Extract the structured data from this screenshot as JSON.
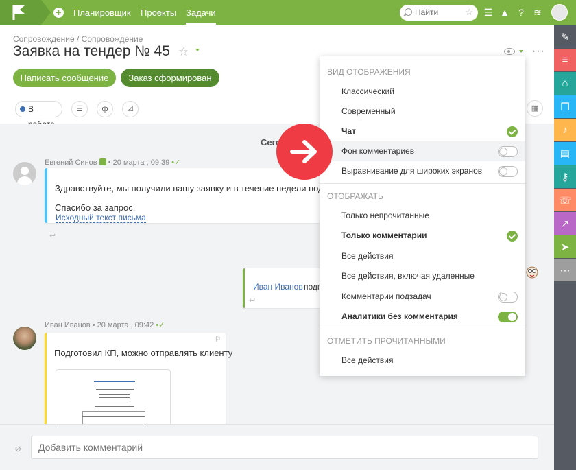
{
  "topbar": {
    "nav": [
      "Планировщик",
      "Проекты",
      "Задачи"
    ],
    "search_placeholder": "Найти"
  },
  "task": {
    "breadcrumb": "Сопровождение / Сопровождение",
    "title": "Заявка на тендер № 45",
    "buttons": {
      "message": "Написать сообщение",
      "order": "Заказ сформирован"
    },
    "status": "В работе"
  },
  "feed": {
    "day_label": "Сего",
    "messages": [
      {
        "author": "Евгений Синов",
        "time": "20 марта , 09:39",
        "line1": "Здравствуйте, мы получили вашу заявку и в течение недели подготови",
        "line2": "Спасибо за запрос.",
        "link": "Исходный текст письма"
      },
      {
        "author_link": "Иван Иванов",
        "text": "подг"
      },
      {
        "author": "Иван Иванов",
        "time": "20 марта , 09:42",
        "text": "Подготовил КП, можно отправлять клиенту"
      }
    ]
  },
  "comment": {
    "placeholder": "Добавить комментарий"
  },
  "dropdown": {
    "section_view": "ВИД ОТОБРАЖЕНИЯ",
    "view_items": [
      "Классический",
      "Современный",
      "Чат",
      "Фон комментариев",
      "Выравнивание для широких экранов"
    ],
    "section_show": "ОТОБРАЖАТЬ",
    "show_items": [
      "Только непрочитанные",
      "Только комментарии",
      "Все действия",
      "Все действия, включая удаленные",
      "Комментарии подзадач",
      "Аналитики без комментария"
    ],
    "section_mark": "ОТМЕТИТЬ ПРОЧИТАННЫМИ",
    "mark_items": [
      "Все действия"
    ]
  },
  "colors": {
    "brand": "#7cb342",
    "brand_dark": "#558b2f",
    "accent_red": "#ef3b43",
    "sidebar": "#555a63"
  },
  "sidebar_icons": [
    "edit-icon",
    "list-icon",
    "hierarchy-icon",
    "copy-icon",
    "bell-icon",
    "clipboard-icon",
    "key-icon",
    "phone-icon",
    "chart-icon",
    "send-icon",
    "more-icon"
  ]
}
